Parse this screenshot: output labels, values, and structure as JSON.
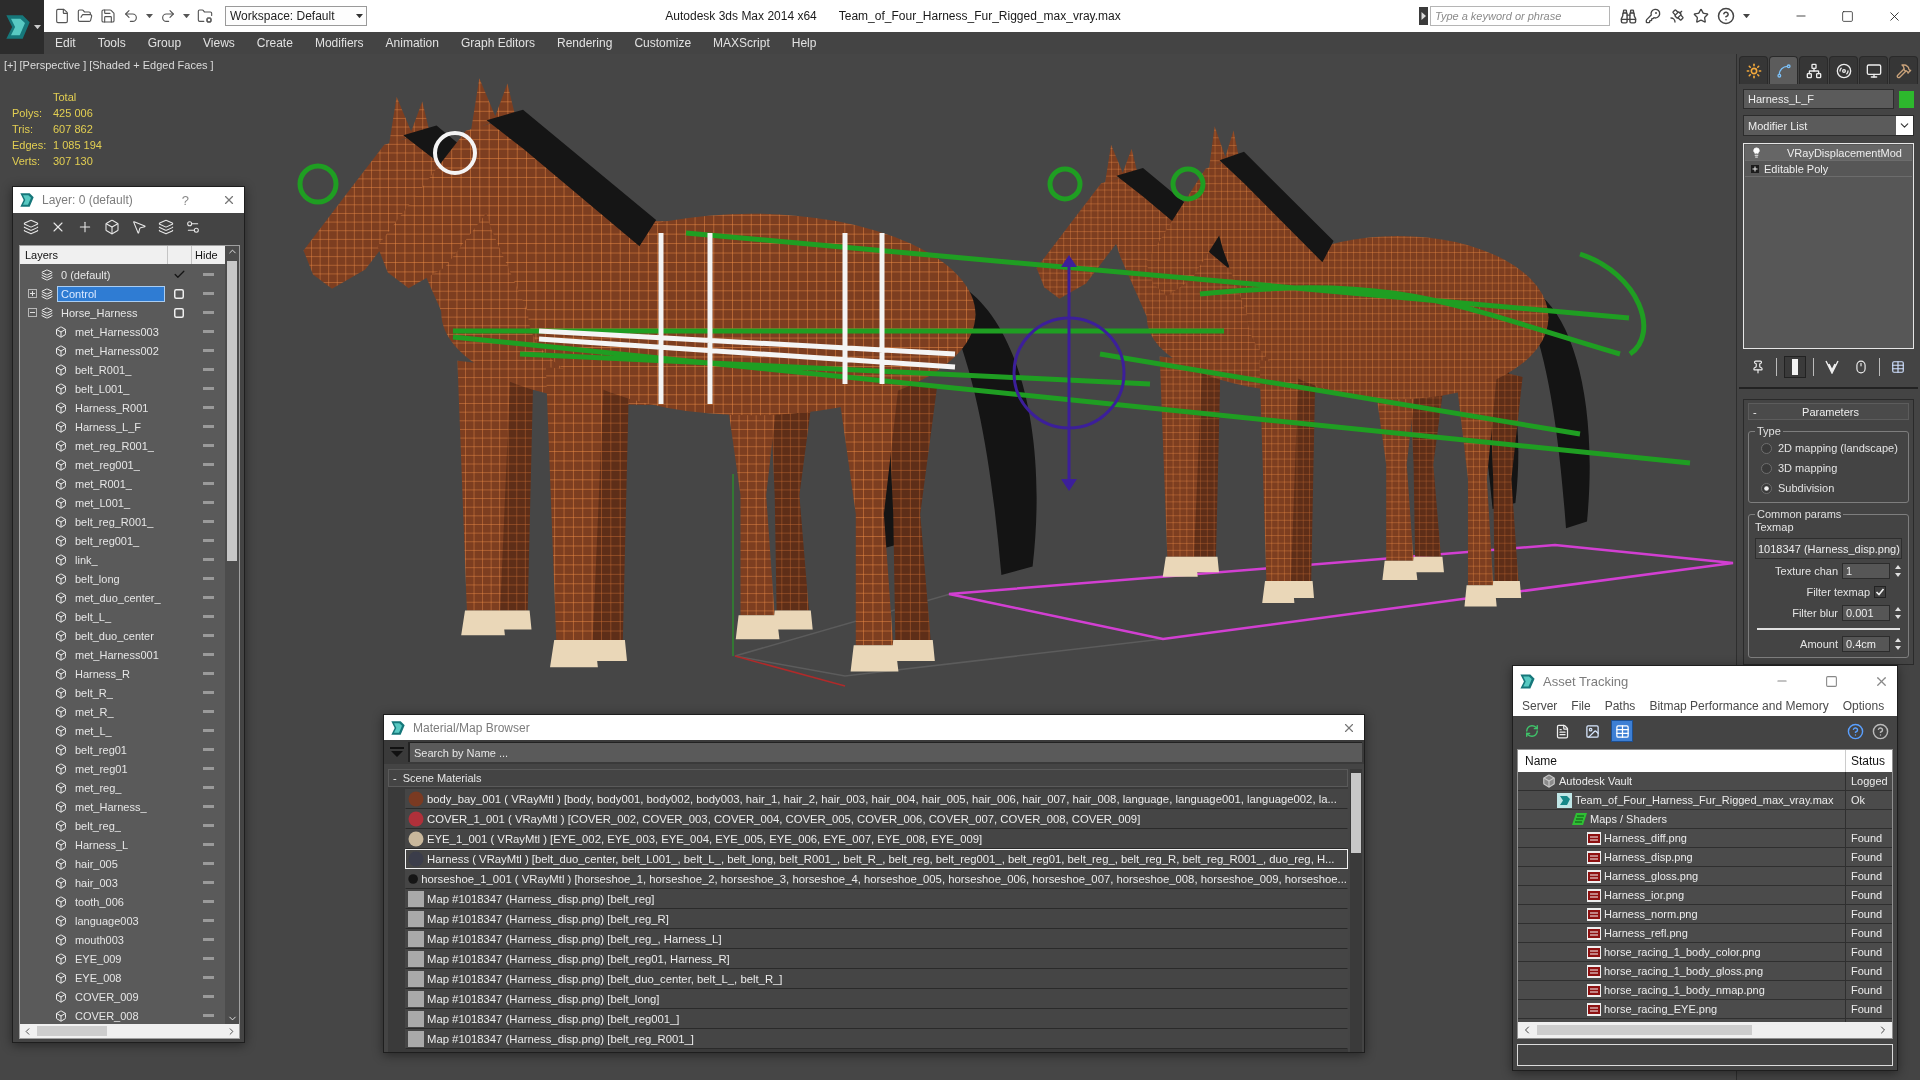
{
  "title_bar": {
    "workspace": "Workspace: Default",
    "app_title": "Autodesk 3ds Max 2014 x64",
    "file_name": "Team_of_Four_Harness_Fur_Rigged_max_vray.max",
    "search": {
      "placeholder": "Type a keyword or phrase"
    }
  },
  "menu_bar": [
    "Edit",
    "Tools",
    "Group",
    "Views",
    "Create",
    "Modifiers",
    "Animation",
    "Graph Editors",
    "Rendering",
    "Customize",
    "MAXScript",
    "Help"
  ],
  "viewport": {
    "labels": [
      "[+]",
      "[Perspective ]",
      "[Shaded + Edged Faces ]"
    ],
    "stats": {
      "header": "Total",
      "rows": [
        {
          "label": "Polys:",
          "value": "425 006"
        },
        {
          "label": "Tris:",
          "value": "607 862"
        },
        {
          "label": "Edges:",
          "value": "1 085 194"
        },
        {
          "label": "Verts:",
          "value": "307 130"
        }
      ]
    }
  },
  "layer_explorer": {
    "title": "Layer: 0 (default)",
    "help": "?",
    "columns": [
      "Layers",
      "Hide"
    ],
    "layers": [
      {
        "name": "0 (default)",
        "current": true,
        "selected": false,
        "hidden": false
      },
      {
        "name": "Control",
        "current": false,
        "selected": true,
        "expanded": false,
        "hidden": false
      },
      {
        "name": "Horse_Harness",
        "current": false,
        "selected": false,
        "expanded": true,
        "hidden": false,
        "children": [
          {
            "name": "met_Harness003",
            "selected": false,
            "hidden": false
          },
          {
            "name": "met_Harness002",
            "selected": false,
            "hidden": false
          },
          {
            "name": "belt_R001_",
            "selected": false,
            "hidden": false
          },
          {
            "name": "belt_L001_",
            "selected": false,
            "hidden": false
          },
          {
            "name": "Harness_R001",
            "selected": false,
            "hidden": false
          },
          {
            "name": "Harness_L_F",
            "selected": false,
            "hidden": false
          },
          {
            "name": "met_reg_R001_",
            "selected": false,
            "hidden": false
          },
          {
            "name": "met_reg001_",
            "selected": false,
            "hidden": false
          },
          {
            "name": "met_R001_",
            "selected": false,
            "hidden": false
          },
          {
            "name": "met_L001_",
            "selected": false,
            "hidden": false
          },
          {
            "name": "belt_reg_R001_",
            "selected": false,
            "hidden": false
          },
          {
            "name": "belt_reg001_",
            "selected": false,
            "hidden": false
          },
          {
            "name": "link_",
            "selected": false,
            "hidden": false
          },
          {
            "name": "belt_long",
            "selected": false,
            "hidden": false
          },
          {
            "name": "met_duo_center_",
            "selected": false,
            "hidden": false
          },
          {
            "name": "belt_L_",
            "selected": false,
            "hidden": false
          },
          {
            "name": "belt_duo_center",
            "selected": false,
            "hidden": false
          },
          {
            "name": "met_Harness001",
            "selected": false,
            "hidden": false
          },
          {
            "name": "Harness_R",
            "selected": false,
            "hidden": false
          },
          {
            "name": "belt_R_",
            "selected": false,
            "hidden": false
          },
          {
            "name": "met_R_",
            "selected": false,
            "hidden": false
          },
          {
            "name": "met_L_",
            "selected": false,
            "hidden": false
          },
          {
            "name": "belt_reg01",
            "selected": false,
            "hidden": false
          },
          {
            "name": "met_reg01",
            "selected": false,
            "hidden": false
          },
          {
            "name": "met_reg_",
            "selected": false,
            "hidden": false
          },
          {
            "name": "met_Harness_",
            "selected": false,
            "hidden": false
          },
          {
            "name": "belt_reg_",
            "selected": false,
            "hidden": false
          },
          {
            "name": "Harness_L",
            "selected": false,
            "hidden": false
          },
          {
            "name": "hair_005",
            "selected": false,
            "hidden": false
          },
          {
            "name": "hair_003",
            "selected": false,
            "hidden": false
          },
          {
            "name": "tooth_006",
            "selected": false,
            "hidden": false
          },
          {
            "name": "language003",
            "selected": false,
            "hidden": false
          },
          {
            "name": "mouth003",
            "selected": false,
            "hidden": false
          },
          {
            "name": "EYE_009",
            "selected": false,
            "hidden": false
          },
          {
            "name": "EYE_008",
            "selected": false,
            "hidden": false
          },
          {
            "name": "COVER_009",
            "selected": false,
            "hidden": false
          },
          {
            "name": "COVER_008",
            "selected": false,
            "hidden": false
          }
        ]
      }
    ]
  },
  "command_panel": {
    "tabs": [
      {
        "kind": "create",
        "selected": false
      },
      {
        "kind": "modify",
        "selected": true
      },
      {
        "kind": "hierarchy",
        "selected": false
      },
      {
        "kind": "motion",
        "selected": false
      },
      {
        "kind": "display",
        "selected": false
      },
      {
        "kind": "utilities",
        "selected": false
      }
    ],
    "object_name": "Harness_L_F",
    "modifier_list": "Modifier List",
    "stack": [
      {
        "kind": "modifier",
        "name": "VRayDisplacementMod",
        "selected": true,
        "on": true
      },
      {
        "kind": "base",
        "name": "Editable Poly",
        "selected": false,
        "expanded": false
      }
    ],
    "stack_toolbar": [
      {
        "kind": "pin",
        "on": false
      },
      {
        "kind": "end_result",
        "on": true
      },
      {
        "kind": "unique",
        "on": false
      },
      {
        "kind": "remove",
        "on": false
      },
      {
        "kind": "configure",
        "on": false
      }
    ],
    "rollout": {
      "collapse": "-",
      "title": "Parameters",
      "type_group": {
        "title": "Type",
        "options": [
          {
            "label": "2D mapping (landscape)",
            "selected": false
          },
          {
            "label": "3D mapping",
            "selected": false
          },
          {
            "label": "Subdivision",
            "selected": true
          }
        ]
      },
      "common_group": {
        "title": "Common params",
        "texmap_label": "Texmap",
        "texmap": "1018347 (Harness_disp.png)",
        "fields": [
          {
            "kind": "spinner",
            "label": "Texture chan",
            "value": "1"
          },
          {
            "kind": "checkbox",
            "label": "Filter texmap",
            "checked": true
          },
          {
            "kind": "spinner",
            "label": "Filter blur",
            "value": "0.001"
          },
          {
            "kind": "separator"
          },
          {
            "kind": "spinner",
            "label": "Amount",
            "value": "0.4cm"
          }
        ]
      }
    }
  },
  "material_browser": {
    "title": "Material/Map Browser",
    "search": {
      "placeholder": "Search by Name ..."
    },
    "group": {
      "collapse": "-",
      "title": "Scene Materials"
    },
    "items": [
      {
        "kind": "material",
        "color": "#7a3a22",
        "selected": false,
        "text": "body_bay_001 ( VRayMtl ) [body, body001, body002, body003, hair_1, hair_2, hair_003, hair_004, hair_005, hair_006, hair_007, hair_008, language, language001, language002, la..."
      },
      {
        "kind": "material",
        "color": "#b0303a",
        "selected": false,
        "text": "COVER_1_001 ( VRayMtl ) [COVER_002, COVER_003, COVER_004, COVER_005, COVER_006, COVER_007, COVER_008, COVER_009]"
      },
      {
        "kind": "material",
        "color": "#c9b89c",
        "selected": false,
        "text": "EYE_1_001 ( VRayMtl ) [EYE_002, EYE_003, EYE_004, EYE_005, EYE_006, EYE_007, EYE_008, EYE_009]"
      },
      {
        "kind": "material",
        "color": "#3b3d4a",
        "selected": true,
        "text": "Harness ( VRayMtl ) [belt_duo_center, belt_L001_, belt_L_, belt_long, belt_R001_, belt_R_, belt_reg, belt_reg001_, belt_reg01, belt_reg_, belt_reg_R, belt_reg_R001_, duo_reg, H..."
      },
      {
        "kind": "material",
        "color": "#151515",
        "selected": false,
        "text": "horseshoe_1_001 ( VRayMtl ) [horseshoe_1, horseshoe_2, horseshoe_3, horseshoe_4, horseshoe_005, horseshoe_006, horseshoe_007, horseshoe_008, horseshoe_009, horseshoe..."
      },
      {
        "kind": "map",
        "selected": false,
        "text": "Map #1018347 (Harness_disp.png) [belt_reg]"
      },
      {
        "kind": "map",
        "selected": false,
        "text": "Map #1018347 (Harness_disp.png) [belt_reg_R]"
      },
      {
        "kind": "map",
        "selected": false,
        "text": "Map #1018347 (Harness_disp.png) [belt_reg_, Harness_L]"
      },
      {
        "kind": "map",
        "selected": false,
        "text": "Map #1018347 (Harness_disp.png) [belt_reg01, Harness_R]"
      },
      {
        "kind": "map",
        "selected": false,
        "text": "Map #1018347 (Harness_disp.png) [belt_duo_center, belt_L_, belt_R_]"
      },
      {
        "kind": "map",
        "selected": false,
        "text": "Map #1018347 (Harness_disp.png) [belt_long]"
      },
      {
        "kind": "map",
        "selected": false,
        "text": "Map #1018347 (Harness_disp.png) [belt_reg001_]"
      },
      {
        "kind": "map",
        "selected": false,
        "text": "Map #1018347 (Harness_disp.png) [belt_reg_R001_]"
      }
    ]
  },
  "asset_tracking": {
    "title": "Asset Tracking",
    "menu": [
      "Server",
      "File",
      "Paths",
      "Bitmap Performance and Memory",
      "Options"
    ],
    "toolbar": [
      {
        "kind": "refresh",
        "selected": false
      },
      {
        "kind": "list",
        "selected": false
      },
      {
        "kind": "thumbnails",
        "selected": false
      },
      {
        "kind": "table",
        "selected": true
      }
    ],
    "columns": [
      "Name",
      "Status"
    ],
    "tree": [
      {
        "kind": "vault",
        "name": "Autodesk Vault",
        "status": "Logged",
        "children": [
          {
            "kind": "scene",
            "name": "Team_of_Four_Harness_Fur_Rigged_max_vray.max",
            "status": "Ok",
            "children": [
              {
                "kind": "folder",
                "name": "Maps / Shaders",
                "children": [
                  {
                    "kind": "png",
                    "name": "Harness_diff.png",
                    "status": "Found"
                  },
                  {
                    "kind": "png",
                    "name": "Harness_disp.png",
                    "status": "Found"
                  },
                  {
                    "kind": "png",
                    "name": "Harness_gloss.png",
                    "status": "Found"
                  },
                  {
                    "kind": "png",
                    "name": "Harness_ior.png",
                    "status": "Found"
                  },
                  {
                    "kind": "png",
                    "name": "Harness_norm.png",
                    "status": "Found"
                  },
                  {
                    "kind": "png",
                    "name": "Harness_refl.png",
                    "status": "Found"
                  },
                  {
                    "kind": "png",
                    "name": "horse_racing_1_body_color.png",
                    "status": "Found"
                  },
                  {
                    "kind": "png",
                    "name": "horse_racing_1_body_gloss.png",
                    "status": "Found"
                  },
                  {
                    "kind": "png",
                    "name": "horse_racing_1_body_nmap.png",
                    "status": "Found"
                  },
                  {
                    "kind": "png",
                    "name": "horse_racing_EYE.png",
                    "status": "Found"
                  }
                ]
              }
            ]
          }
        ]
      }
    ]
  }
}
